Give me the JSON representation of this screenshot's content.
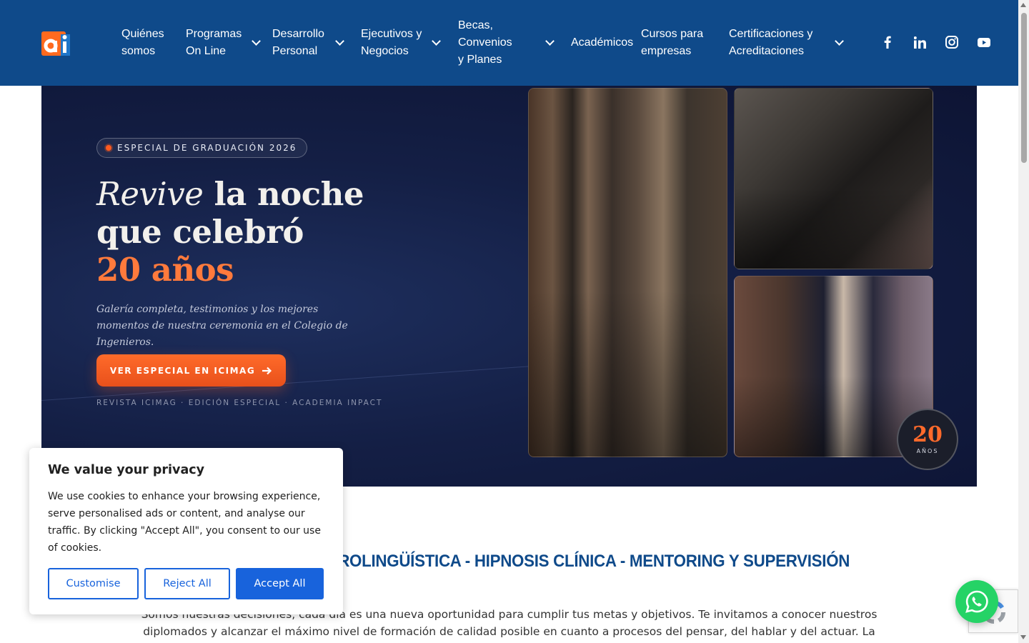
{
  "header": {
    "bg_color": "#0f4a8a",
    "logo_alt": "ai",
    "nav": [
      {
        "label": "Quiénes\nsomos",
        "has_dropdown": false
      },
      {
        "label": "Programas\nOn Line",
        "has_dropdown": true
      },
      {
        "label": "Desarrollo\nPersonal",
        "has_dropdown": true
      },
      {
        "label": "Ejecutivos y\nNegocios",
        "has_dropdown": true
      },
      {
        "label": "Becas, Convenios\ny Planes",
        "has_dropdown": true
      },
      {
        "label": "Académicos",
        "has_dropdown": false
      },
      {
        "label": "Cursos para\nempresas",
        "has_dropdown": false
      },
      {
        "label": "Certificaciones y\nAcreditaciones",
        "has_dropdown": true
      }
    ],
    "social": [
      "facebook-icon",
      "linkedin-icon",
      "instagram-icon",
      "youtube-icon"
    ]
  },
  "hero": {
    "badge": "ESPECIAL DE GRADUACIÓN 2026",
    "headline_italic": "Revive",
    "headline_l1_rest": " la noche",
    "headline_l2": "que celebró",
    "headline_l3": "20 años",
    "subtitle": "Galería completa, testimonios y los mejores momentos de nuestra ceremonia en el Colegio de Ingenieros.",
    "cta_label": "VER ESPECIAL EN ICIMAG",
    "footer": "REVISTA ICIMAG · EDICIÓN ESPECIAL · ACADEMIA INPACT",
    "seal_number": "20",
    "seal_text": "AÑOS",
    "accent_color": "#ff6a2b"
  },
  "content": {
    "title": "PROGRAMACIÓN NEUROLINGÜÍSTICA - HIPNOSIS CLÍNICA - MENTORING Y SUPERVISIÓN",
    "text": "Somos nuestras decisiones, cada día es una nueva oportunidad para cumplir tus metas y objetivos. Te invitamos a conocer nuestros diplomados y alcanzar el máximo nivel de formación de calidad posible en cuanto a procesos del pensar, del hablar y del actuar. La"
  },
  "cookie": {
    "title": "We value your privacy",
    "text": "We use cookies to enhance your browsing experience, serve personalised ads or content, and analyse our traffic. By clicking \"Accept All\", you consent to our use of cookies.",
    "customise": "Customise",
    "reject": "Reject All",
    "accept": "Accept All",
    "button_color": "#1863dc"
  }
}
